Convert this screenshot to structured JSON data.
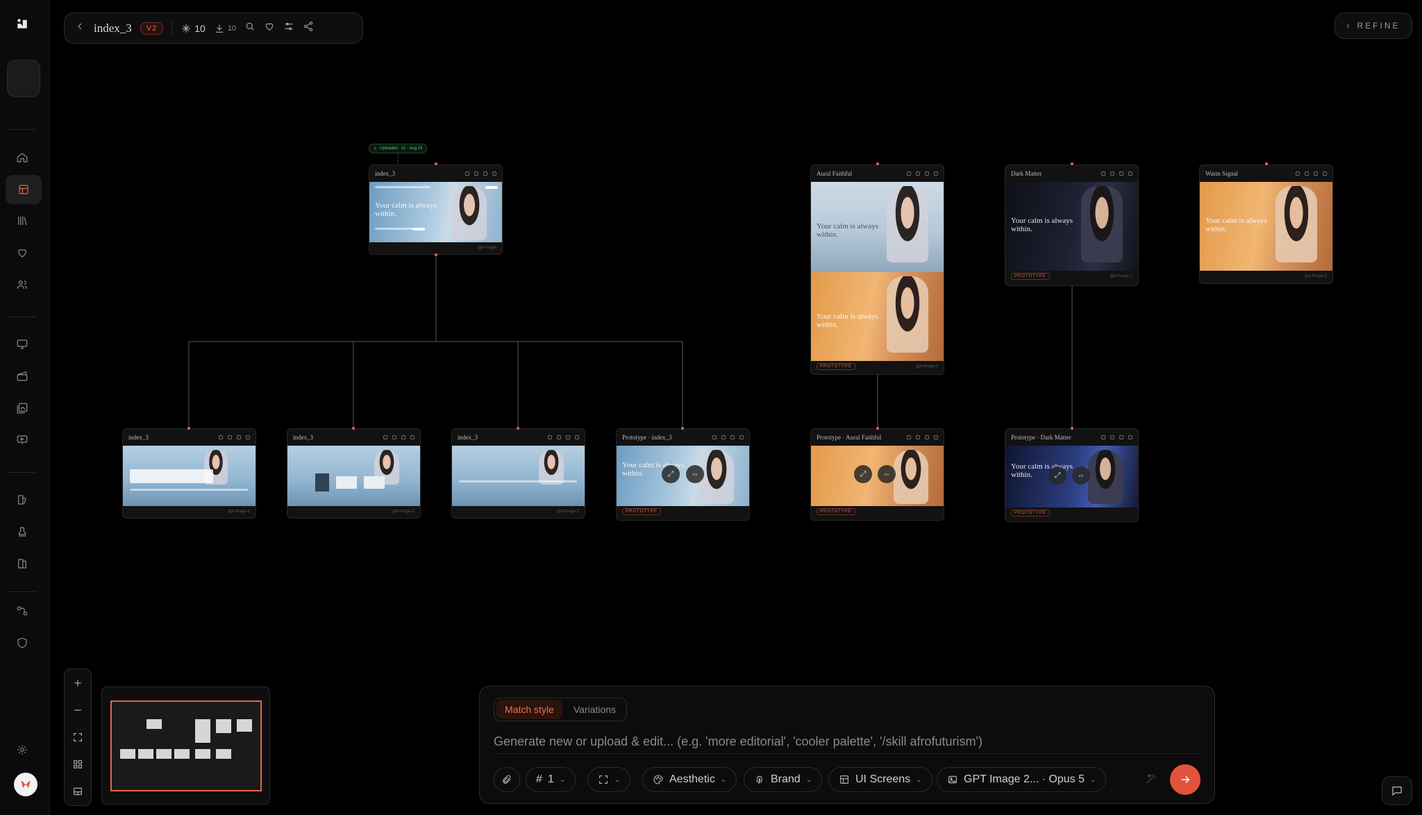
{
  "header": {
    "title": "index_3",
    "version": "V2",
    "stars": "10",
    "downloads": "10"
  },
  "refine_label": "REFINE",
  "uploaded_badge": "Uploaded · v1 · Aug 16",
  "nodes": {
    "root": {
      "title": "index_3",
      "hero": "Your calm is always within.",
      "model": "gpt-image"
    },
    "aural": {
      "title": "Aural Faithful",
      "hero": "Your calm is always within.",
      "hero2": "Your calm is always within.",
      "tag": "PROTOTYPE",
      "model": "gpt-image-2"
    },
    "dark": {
      "title": "Dark Matter",
      "hero": "Your calm is always within.",
      "tag": "PROTOTYPE",
      "model": "gpt-image-2"
    },
    "warm": {
      "title": "Warm Signal",
      "hero": "Your calm is always within.",
      "model": "gpt-image-2"
    },
    "c1": {
      "title": "index_3",
      "model": "gpt-image-2"
    },
    "c2": {
      "title": "index_3",
      "model": "gpt-image-2"
    },
    "c3": {
      "title": "index_3",
      "model": "gpt-image-2"
    },
    "c4": {
      "title": "Prototype · index_3",
      "hero": "Your calm is always within.",
      "tag": "PROTOTYPE"
    },
    "c5": {
      "title": "Prototype · Aural Faithful",
      "tag": "PROTOTYPE"
    },
    "c6": {
      "title": "Prototype · Dark Matter",
      "hero": "Your calm is always within.",
      "tag": "PROTOTYPE"
    }
  },
  "prompt": {
    "tab_active": "Match style",
    "tab_other": "Variations",
    "placeholder": "Generate new or upload & edit... (e.g. 'more editorial', 'cooler palette', '/skill afrofuturism')",
    "count": "1",
    "aesthetic": "Aesthetic",
    "brand": "Brand",
    "ui_screens": "UI Screens",
    "model": "GPT Image 2... · Opus 5"
  },
  "colors": {
    "accent": "#e0674a",
    "bg": "#000000",
    "panel": "#0e0e0e"
  }
}
